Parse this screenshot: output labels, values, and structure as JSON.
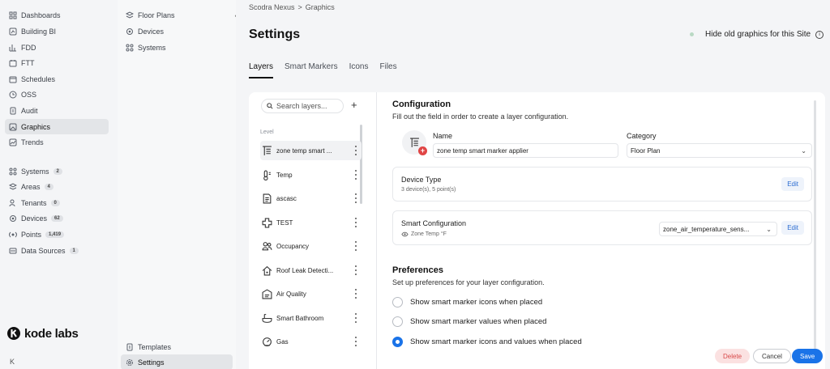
{
  "nav": {
    "items": [
      {
        "label": "Dashboards",
        "icon": "grid-icon",
        "badge": ""
      },
      {
        "label": "Building BI",
        "icon": "chart-icon",
        "badge": ""
      },
      {
        "label": "FDD",
        "icon": "fdd-icon",
        "badge": ""
      },
      {
        "label": "FTT",
        "icon": "ticket-icon",
        "badge": ""
      },
      {
        "label": "Schedules",
        "icon": "calendar-icon",
        "badge": ""
      },
      {
        "label": "OSS",
        "icon": "clock-icon",
        "badge": ""
      },
      {
        "label": "Audit",
        "icon": "audit-icon",
        "badge": ""
      },
      {
        "label": "Graphics",
        "icon": "image-icon",
        "badge": ""
      },
      {
        "label": "Trends",
        "icon": "trend-icon",
        "badge": ""
      }
    ],
    "items2": [
      {
        "label": "Systems",
        "icon": "systems-icon",
        "badge": "2"
      },
      {
        "label": "Areas",
        "icon": "areas-icon",
        "badge": "4"
      },
      {
        "label": "Tenants",
        "icon": "tenants-icon",
        "badge": "0"
      },
      {
        "label": "Devices",
        "icon": "device-icon",
        "badge": "62"
      },
      {
        "label": "Points",
        "icon": "points-icon",
        "badge": "1,419"
      },
      {
        "label": "Data Sources",
        "icon": "data-source-icon",
        "badge": "1"
      }
    ],
    "logo_text": "kode labs",
    "collapse_glyph": "K"
  },
  "subnav": {
    "top": [
      "Floor Plans",
      "Devices",
      "Systems"
    ],
    "bottom": [
      "Templates",
      "Settings"
    ]
  },
  "breadcrumb": {
    "root": "Scodra Nexus",
    "sep": ">",
    "current": "Graphics"
  },
  "page": {
    "title": "Settings",
    "hide_old_label": "Hide old graphics for this Site",
    "tabs": [
      "Layers",
      "Smart Markers",
      "Icons",
      "Files"
    ]
  },
  "layers": {
    "search_placeholder": "Search layers...",
    "add_glyph": "+",
    "level_label": "Level",
    "items": [
      {
        "name": "zone temp smart ...",
        "icon": "list-icon"
      },
      {
        "name": "Temp",
        "icon": "thermometer-icon"
      },
      {
        "name": "ascasc",
        "icon": "document-icon"
      },
      {
        "name": "TEST",
        "icon": "cross-icon"
      },
      {
        "name": "Occupancy",
        "icon": "people-icon"
      },
      {
        "name": "Roof Leak Detecti...",
        "icon": "roof-icon"
      },
      {
        "name": "Air Quality",
        "icon": "air-quality-icon"
      },
      {
        "name": "Smart Bathroom",
        "icon": "bathroom-icon"
      },
      {
        "name": "Gas",
        "icon": "gas-icon"
      }
    ]
  },
  "config": {
    "title": "Configuration",
    "subtitle": "Fill out the field in order to create a layer configuration.",
    "name_label": "Name",
    "name_value": "zone temp smart marker applier",
    "category_label": "Category",
    "category_value": "Floor Plan",
    "device_type": {
      "title": "Device Type",
      "sub": "3 device(s), 5 point(s)",
      "edit": "Edit"
    },
    "smart_config": {
      "title": "Smart Configuration",
      "sub": "Zone Temp °F",
      "select": "zone_air_temperature_sens...",
      "edit": "Edit"
    }
  },
  "prefs": {
    "title": "Preferences",
    "subtitle": "Set up preferences for your layer configuration.",
    "options": [
      {
        "label": "Show smart marker icons when placed",
        "checked": false
      },
      {
        "label": "Show smart marker values when placed",
        "checked": false
      },
      {
        "label": "Show smart marker icons and values when placed",
        "checked": true
      }
    ]
  },
  "footer": {
    "delete": "Delete",
    "cancel": "Cancel",
    "save": "Save"
  },
  "colors": {
    "accent": "#1a73e8",
    "danger": "#e04545"
  }
}
